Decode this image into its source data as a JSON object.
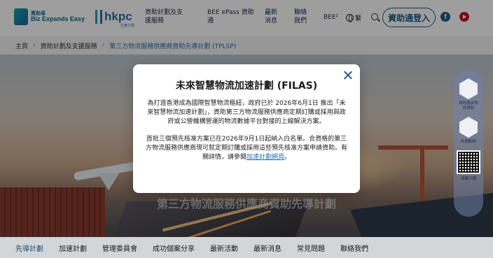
{
  "header": {
    "logo_cn": "資助易",
    "logo_en": "Biz Expands Easy",
    "hkpc": "hkpc",
    "hkpc_sub": "生產力局",
    "nav": [
      {
        "label": "資助計劃及支援服務"
      },
      {
        "label": "BEE ePass 資助通"
      },
      {
        "label": "最新消息"
      },
      {
        "label": "聯絡我們"
      },
      {
        "label": "BEE²"
      }
    ],
    "lang": "繁",
    "login": "資助通登入",
    "facebook": "f"
  },
  "breadcrumb": {
    "home": "主頁",
    "section": "資助計劃及支援服務",
    "current": "第三方物流服務供應商資助先導計劃 (TPLSP)"
  },
  "banner": {
    "title": "第三方物流服務供應商資助先導計劃"
  },
  "side_widget": {
    "item1": "尋找適合你的資助",
    "item2": "計劃配對",
    "qr_label": "掃碼下載"
  },
  "modal": {
    "title": "未來智慧物流加速計劃 (FILAS)",
    "para1": "為打造香港成為國際智慧物流樞紐，政府已於 2026年6月1日 推出「未來智慧物流加速計劃」，資助第三方物流服務供應商定期訂購或採用與政府或公營機構營運的物流數據平台對接的上線解決方案。",
    "para2_prefix": "首批三個預先核准方案已在2026年9月1日起納入白名單。合資格的第三方物流服務供應商現可就定期訂購或採用這些預先核准方案申請資助。有關詳情，請參閱",
    "para2_link": "加速計劃網頁",
    "para2_suffix": "。"
  },
  "tabs": [
    {
      "label": "先導計劃"
    },
    {
      "label": "加速計劃"
    },
    {
      "label": "管理委員會"
    },
    {
      "label": "成功個案分享"
    },
    {
      "label": "最新活動"
    },
    {
      "label": "最新消息"
    },
    {
      "label": "常見問題"
    },
    {
      "label": "聯絡我們"
    }
  ],
  "colors": {
    "brand_blue": "#1e5b8a",
    "link_blue": "#2a6fb0",
    "youtube_red": "#c8102e"
  }
}
